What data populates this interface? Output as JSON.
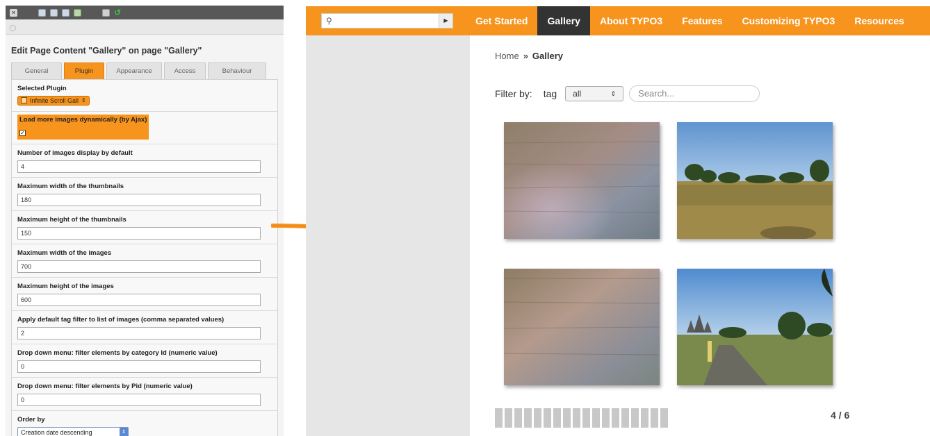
{
  "backend": {
    "close_glyph": "×",
    "undo_glyph": "↺",
    "title": "Edit Page Content \"Gallery\" on page \"Gallery\"",
    "tabs": [
      {
        "label": "General",
        "active": false
      },
      {
        "label": "Plugin",
        "active": true
      },
      {
        "label": "Appearance",
        "active": false
      },
      {
        "label": "Access",
        "active": false
      },
      {
        "label": "Behaviour",
        "active": false
      }
    ],
    "selected_plugin_label": "Selected Plugin",
    "selected_plugin_value": "Infinite Scroll Gall",
    "ajax_label": "Load more images dynamically (by Ajax)",
    "ajax_checked": "✓",
    "fields": [
      {
        "label": "Number of images display by default",
        "value": "4"
      },
      {
        "label": "Maximum width of the thumbnails",
        "value": "180"
      },
      {
        "label": "Maximum height of the thumbnails",
        "value": "150"
      },
      {
        "label": "Maximum width of the images",
        "value": "700"
      },
      {
        "label": "Maximum height of the images",
        "value": "600"
      },
      {
        "label": "Apply default tag filter to list of images (comma separated values)",
        "value": "2"
      },
      {
        "label": "Drop down menu: filter elements by category Id (numeric value)",
        "value": "0"
      },
      {
        "label": "Drop down menu: filter elements by Pid (numeric value)",
        "value": "0"
      }
    ],
    "order_label": "Order by",
    "order_value": "Creation date descending"
  },
  "frontend": {
    "nav": [
      "Get Started",
      "Gallery",
      "About TYPO3",
      "Features",
      "Customizing TYPO3",
      "Resources"
    ],
    "active_nav": "Gallery",
    "breadcrumb": {
      "home": "Home",
      "sep": "»",
      "current": "Gallery"
    },
    "filter": {
      "label": "Filter by:",
      "tag_label": "tag",
      "tag_value": "all",
      "search_placeholder": "Search..."
    },
    "counter": "4 / 6"
  },
  "colors": {
    "orange": "#f7941d",
    "nav_active": "#333333",
    "sidebar": "#e6e6e6"
  },
  "icons": [
    "close-icon",
    "save-icon",
    "trash-icon",
    "undo-icon",
    "search-icon",
    "arrow-right-icon",
    "checkbox-icon",
    "select-arrows-icon"
  ]
}
